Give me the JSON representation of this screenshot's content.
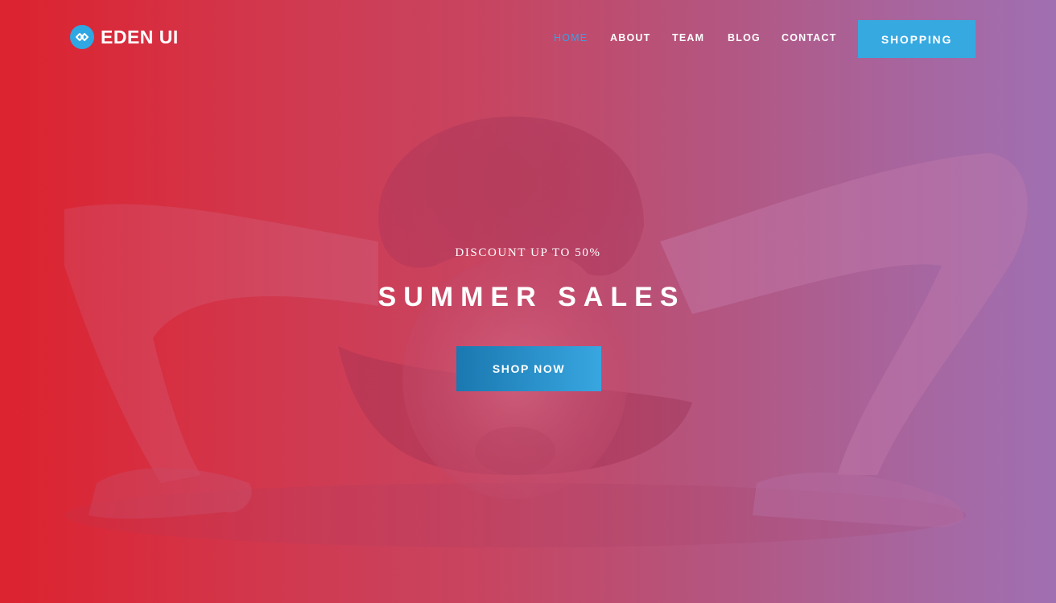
{
  "brand": {
    "name": "EDEN UI",
    "icon": "link-icon",
    "icon_color": "#2fa7e3"
  },
  "nav": {
    "items": [
      {
        "label": "HOME",
        "active": true
      },
      {
        "label": "ABOUT",
        "active": false
      },
      {
        "label": "TEAM",
        "active": false
      },
      {
        "label": "BLOG",
        "active": false
      },
      {
        "label": "CONTACT",
        "active": false
      }
    ],
    "active_color": "#3aa0e8",
    "cta_label": "SHOPPING",
    "cta_color": "#36a9e1"
  },
  "hero": {
    "kicker": "DISCOUNT UP TO 50%",
    "title": "SUMMER SALES",
    "button_label": "SHOP NOW",
    "gradient_start": "#dc2330",
    "gradient_end": "#a070b0"
  }
}
